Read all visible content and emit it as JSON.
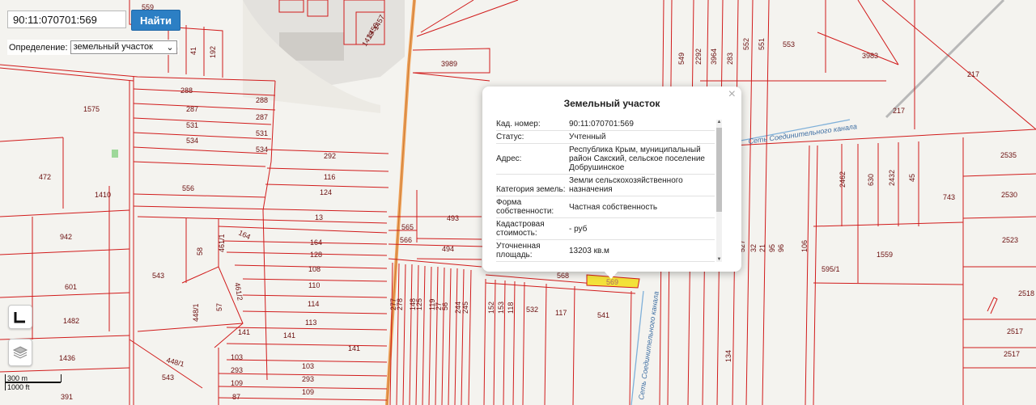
{
  "search": {
    "value": "90:11:070701:569",
    "button_label": "Найти"
  },
  "definition": {
    "label": "Определение:",
    "selected": "земельный участок",
    "arrow": "⌄"
  },
  "controls": {
    "measure_icon": "ruler-icon",
    "layers_icon": "layers-icon"
  },
  "scale": {
    "metric": "300 m",
    "imperial": "1000 ft"
  },
  "popup": {
    "title": "Земельный участок",
    "close": "×",
    "rows": [
      {
        "k": "Кад. номер:",
        "v": "90:11:070701:569"
      },
      {
        "k": "Статус:",
        "v": "Учтенный"
      },
      {
        "k": "Адрес:",
        "v": "Республика Крым, муниципальный район Сакский, сельское поселение Добрушинское"
      },
      {
        "k": "Категория земель:",
        "v": "Земли сельскохозяйственного назначения"
      },
      {
        "k": "Форма собственности:",
        "v": "Частная собственность"
      },
      {
        "k": "Кадастровая стоимость:",
        "v": "- руб"
      },
      {
        "k": "Уточненная площадь:",
        "v": "13203 кв.м"
      }
    ]
  },
  "canal_labels": [
    "Сеть Соединительного канала",
    "Сеть Соединительного канала"
  ],
  "plot_labels": [
    "559",
    "38",
    "41",
    "192",
    "1457",
    "1458",
    "1419",
    "3989",
    "549",
    "2292",
    "3964",
    "283",
    "552",
    "551",
    "553",
    "3983",
    "217",
    "217",
    "1575",
    "288",
    "288",
    "287",
    "287",
    "531",
    "531",
    "534",
    "534",
    "292",
    "116",
    "124",
    "472",
    "1410",
    "556",
    "13",
    "942",
    "164",
    "164",
    "128",
    "108",
    "110",
    "114",
    "113",
    "601",
    "543",
    "58",
    "461/1",
    "461/2",
    "57",
    "448/1",
    "1482",
    "1436",
    "141",
    "141",
    "141",
    "448/1",
    "543",
    "103",
    "103",
    "293",
    "293",
    "109",
    "109",
    "87",
    "391",
    "565",
    "566",
    "493",
    "494",
    "568",
    "569",
    "277",
    "278",
    "148",
    "125",
    "119",
    "27",
    "56",
    "244",
    "245",
    "152",
    "153",
    "118",
    "532",
    "117",
    "541",
    "2462",
    "630",
    "2432",
    "45",
    "743",
    "2535",
    "2530",
    "2523",
    "595/1",
    "1559",
    "2518",
    "2517",
    "2517",
    "527",
    "32",
    "21",
    "95",
    "96",
    "106",
    "134"
  ]
}
